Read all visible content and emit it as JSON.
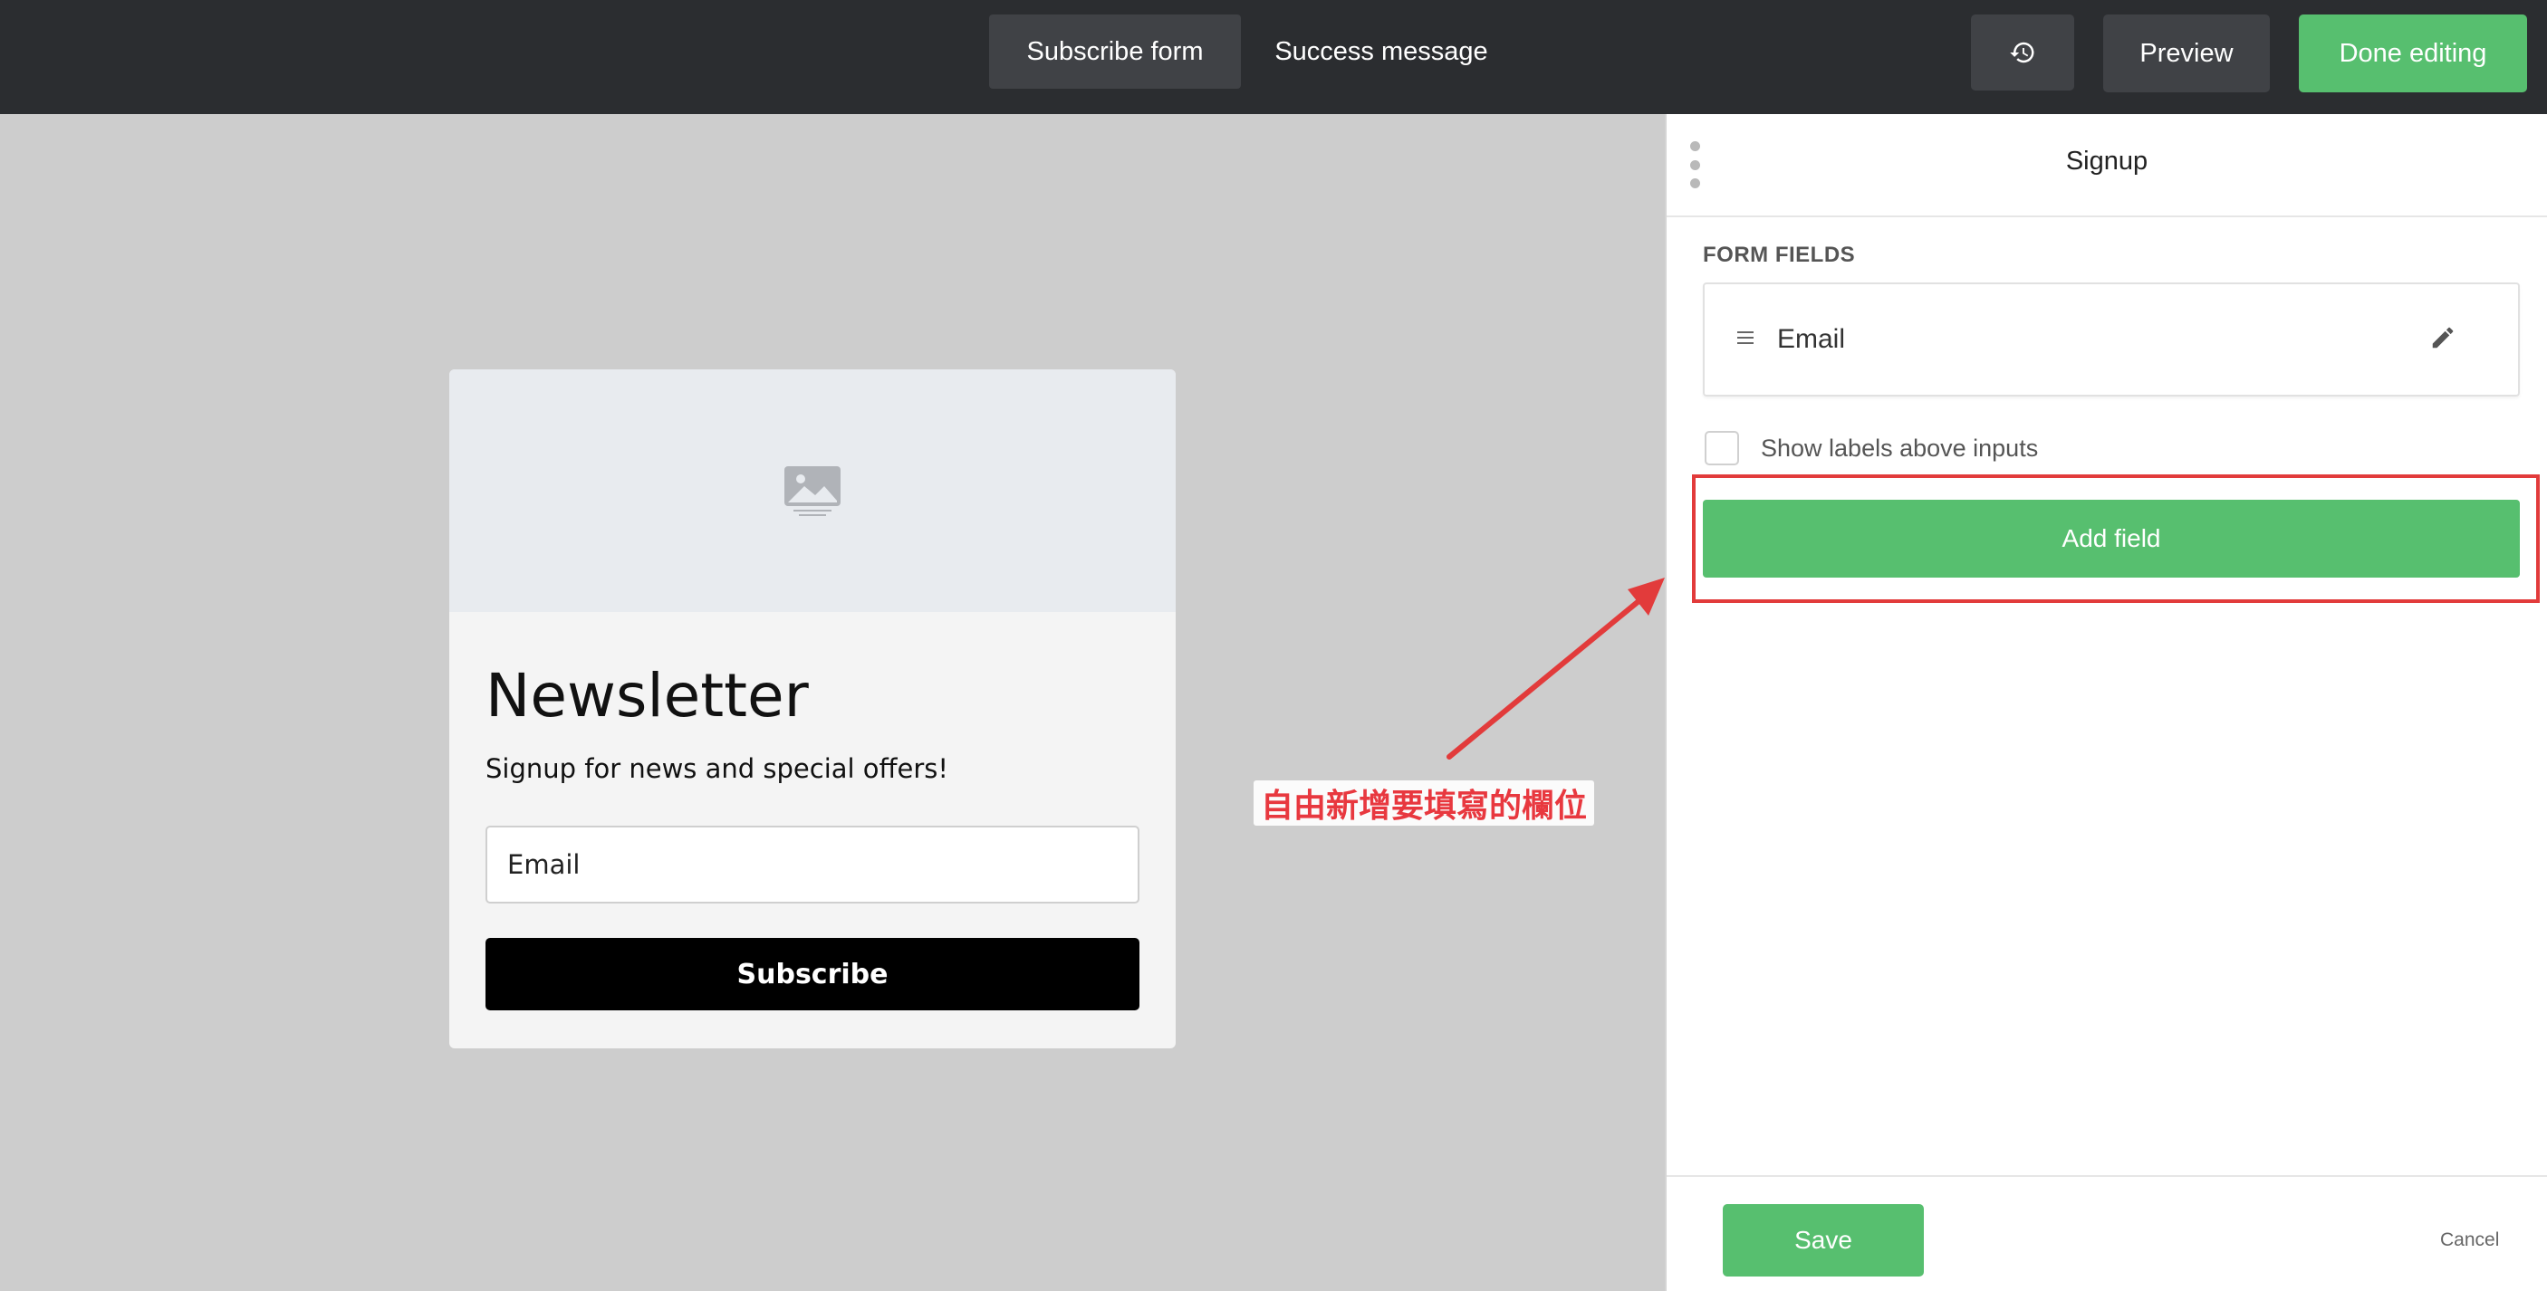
{
  "topbar": {
    "tabs": [
      {
        "label": "Subscribe form",
        "active": true
      },
      {
        "label": "Success message",
        "active": false
      }
    ],
    "history_icon": "history-icon",
    "preview_label": "Preview",
    "done_label": "Done editing"
  },
  "form_card": {
    "image_icon": "image-placeholder-icon",
    "title": "Newsletter",
    "subtitle": "Signup for news and special offers!",
    "email_placeholder": "Email",
    "subscribe_label": "Subscribe"
  },
  "annotation": {
    "text": "自由新增要填寫的欄位"
  },
  "panel": {
    "title": "Signup",
    "section_label": "FORM FIELDS",
    "fields": [
      {
        "label": "Email"
      }
    ],
    "show_labels_text": "Show labels above inputs",
    "show_labels_checked": false,
    "add_field_label": "Add field",
    "save_label": "Save",
    "cancel_label": "Cancel"
  },
  "colors": {
    "accent_green": "#57bf6f",
    "topbar_bg": "#2b2d30",
    "annotation_red": "#e8383f"
  }
}
